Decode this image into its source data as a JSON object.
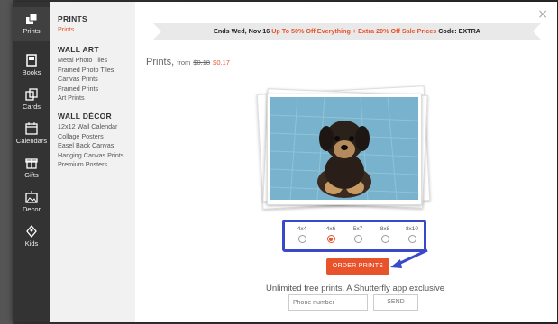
{
  "rail": [
    {
      "label": "Prints",
      "icon": "prints-icon",
      "active": true
    },
    {
      "label": "Books",
      "icon": "books-icon"
    },
    {
      "label": "Cards",
      "icon": "cards-icon"
    },
    {
      "label": "Calendars",
      "icon": "calendars-icon"
    },
    {
      "label": "Gifts",
      "icon": "gifts-icon"
    },
    {
      "label": "Decor",
      "icon": "decor-icon"
    },
    {
      "label": "Kids",
      "icon": "kids-icon"
    }
  ],
  "categories": {
    "prints": {
      "heading": "PRINTS",
      "items": [
        "Prints"
      ]
    },
    "wall_art": {
      "heading": "WALL ART",
      "items": [
        "Metal Photo Tiles",
        "Framed Photo Tiles",
        "Canvas Prints",
        "Framed Prints",
        "Art Prints"
      ]
    },
    "wall_decor": {
      "heading": "WALL DÉCOR",
      "items": [
        "12x12 Wall Calendar",
        "Collage Posters",
        "Easel Back Canvas",
        "Hanging Canvas Prints",
        "Premium Posters"
      ]
    }
  },
  "promo": {
    "prefix": "Ends Wed, Nov 16",
    "sale": "Up To 50% Off Everything + Extra 20% Off Sale Prices",
    "code": "Code: EXTRA"
  },
  "product": {
    "name": "Prints,",
    "from": "from",
    "old_price": "$0.18",
    "price": "$0.17"
  },
  "sizes": [
    {
      "label": "4x4",
      "selected": false
    },
    {
      "label": "4x6",
      "selected": true
    },
    {
      "label": "5x7",
      "selected": false
    },
    {
      "label": "8x8",
      "selected": false
    },
    {
      "label": "8x10",
      "selected": false
    }
  ],
  "order_label": "ORDER PRINTS",
  "free_text": "Unlimited free prints. A Shutterfly app exclusive",
  "phone_placeholder": "Phone number",
  "send_label": "SEND",
  "close_symbol": "×",
  "colors": {
    "accent": "#e8532c",
    "highlight_box": "#3949c9"
  }
}
